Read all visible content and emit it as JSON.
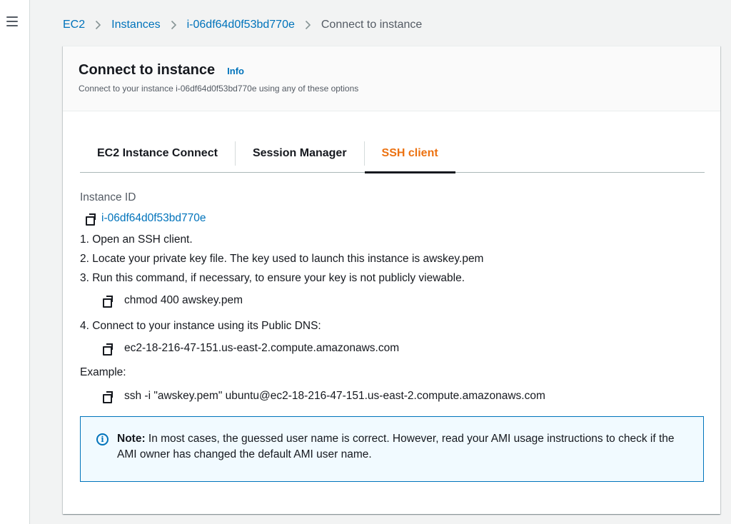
{
  "breadcrumb": {
    "items": [
      "EC2",
      "Instances",
      "i-06df64d0f53bd770e"
    ],
    "current": "Connect to instance"
  },
  "panel": {
    "title": "Connect to instance",
    "info_label": "Info",
    "description": "Connect to your instance i-06df64d0f53bd770e using any of these options"
  },
  "tabs": [
    {
      "label": "EC2 Instance Connect",
      "active": false
    },
    {
      "label": "Session Manager",
      "active": false
    },
    {
      "label": "SSH client",
      "active": true
    }
  ],
  "ssh": {
    "instance_id_label": "Instance ID",
    "instance_id": "i-06df64d0f53bd770e",
    "step1": "1. Open an SSH client.",
    "step2": "2. Locate your private key file. The key used to launch this instance is awskey.pem",
    "step3": "3. Run this command, if necessary, to ensure your key is not publicly viewable.",
    "step3_command": "chmod 400 awskey.pem",
    "step4": "4. Connect to your instance using its Public DNS:",
    "step4_dns": "ec2-18-216-47-151.us-east-2.compute.amazonaws.com",
    "example_label": "Example:",
    "example_command": "ssh -i \"awskey.pem\" ubuntu@ec2-18-216-47-151.us-east-2.compute.amazonaws.com"
  },
  "note": {
    "bold": "Note:",
    "text": " In most cases, the guessed user name is correct. However, read your AMI usage instructions to check if the AMI owner has changed the default AMI user name."
  },
  "colors": {
    "link": "#0073bb",
    "active_tab": "#ec7211",
    "note_border": "#0073bb",
    "note_bg": "#f1faff"
  },
  "icons": {
    "menu": "hamburger-menu-icon",
    "separator": "chevron-right-icon",
    "copy": "copy-icon",
    "info": "info-circle-icon"
  }
}
